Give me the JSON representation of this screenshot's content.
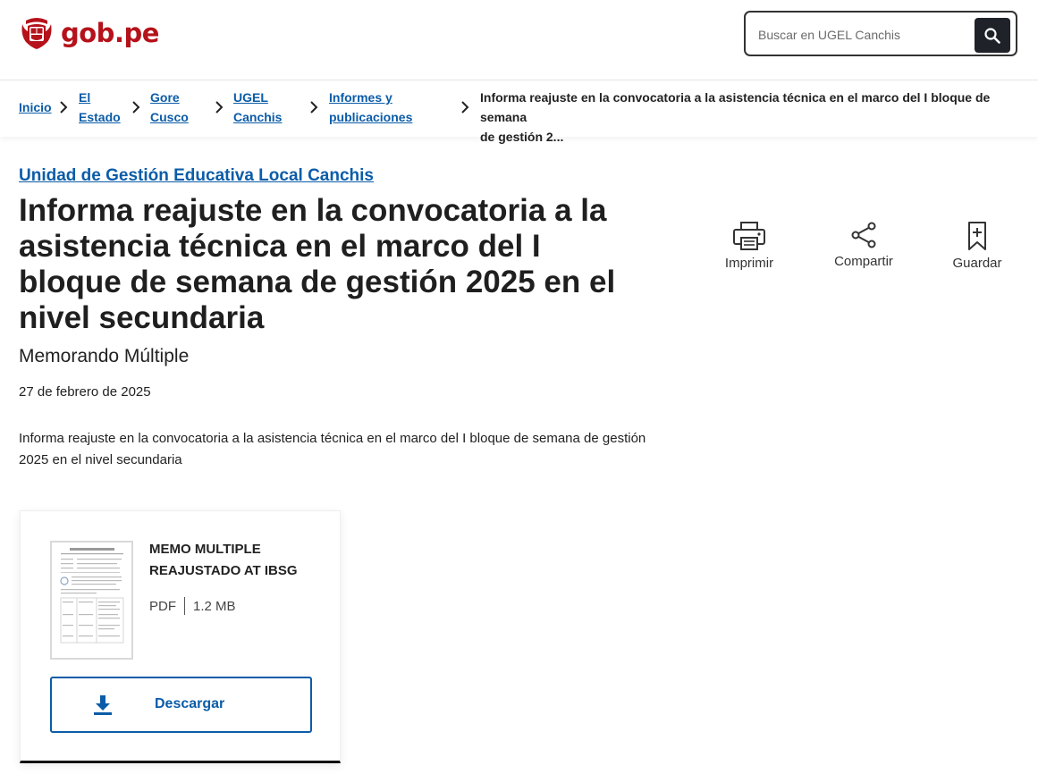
{
  "header": {
    "brand": "gob.pe",
    "search_placeholder": "Buscar en UGEL Canchis"
  },
  "breadcrumb": {
    "items": [
      {
        "line1": "Inicio",
        "line2": ""
      },
      {
        "line1": "El",
        "line2": "Estado"
      },
      {
        "line1": "Gore",
        "line2": "Cusco"
      },
      {
        "line1": "UGEL",
        "line2": "Canchis"
      },
      {
        "line1": "Informes y",
        "line2": "publicaciones"
      }
    ],
    "current_line1": "Informa reajuste en la convocatoria a la asistencia técnica en el marco del I bloque de semana",
    "current_line2": "de gestión 2..."
  },
  "article": {
    "agency": "Unidad de Gestión Educativa Local Canchis",
    "title": "Informa reajuste en la convocatoria a la asistencia técnica en el marco del I bloque de semana de gestión 2025 en el nivel secundaria",
    "subtitle": "Memorando Múltiple",
    "date": "27 de febrero de 2025",
    "summary": "Informa reajuste en la convocatoria a la asistencia técnica en el marco del I bloque de semana de gestión 2025 en el nivel secundaria"
  },
  "actions": {
    "print": "Imprimir",
    "share": "Compartir",
    "save": "Guardar"
  },
  "document": {
    "title": "MEMO MULTIPLE REAJUSTADO AT IBSG",
    "type": "PDF",
    "size": "1.2 MB",
    "download_label": "Descargar"
  },
  "colors": {
    "brand_red": "#b5121b",
    "link_blue": "#0b5ca8",
    "search_button": "#1f2229"
  }
}
